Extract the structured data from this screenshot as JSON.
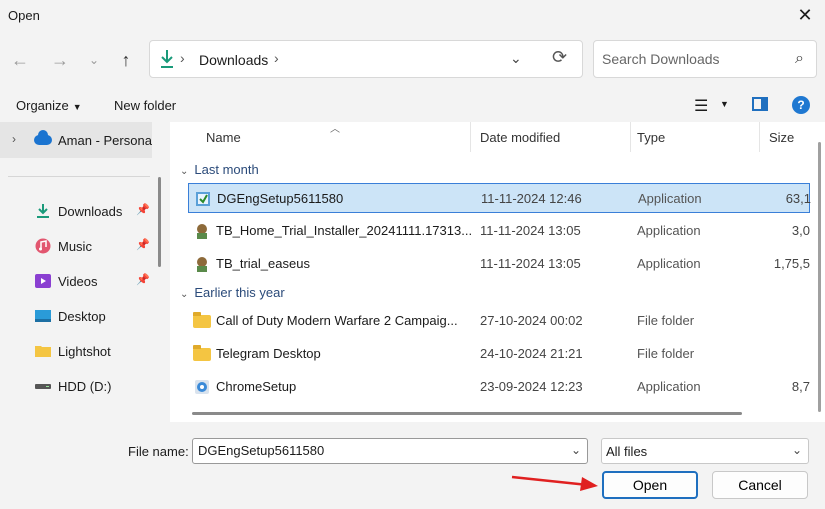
{
  "window": {
    "title": "Open"
  },
  "address": {
    "location": "Downloads"
  },
  "search": {
    "placeholder": "Search Downloads"
  },
  "toolbar": {
    "organize_label": "Organize",
    "new_folder_label": "New folder"
  },
  "sidebar": {
    "onedrive_label": "Aman - Personal",
    "items": [
      {
        "label": "Downloads",
        "icon": "download-icon",
        "pinned": true
      },
      {
        "label": "Music",
        "icon": "music-icon",
        "pinned": true
      },
      {
        "label": "Videos",
        "icon": "videos-icon",
        "pinned": true
      },
      {
        "label": "Desktop",
        "icon": "desktop-icon",
        "pinned": false
      },
      {
        "label": "Lightshot",
        "icon": "folder-icon",
        "pinned": false
      },
      {
        "label": "HDD (D:)",
        "icon": "drive-icon",
        "pinned": false
      }
    ]
  },
  "columns": {
    "name": "Name",
    "date": "Date modified",
    "type": "Type",
    "size": "Size"
  },
  "groups": [
    {
      "label": "Last month",
      "files": [
        {
          "name": "DGEngSetup5611580",
          "date": "11-11-2024 12:46",
          "type": "Application",
          "size": "63,1",
          "icon": "installer-icon",
          "selected": true
        },
        {
          "name": "TB_Home_Trial_Installer_20241111.17313...",
          "date": "11-11-2024 13:05",
          "type": "Application",
          "size": "3,0",
          "icon": "app-icon",
          "selected": false
        },
        {
          "name": "TB_trial_easeus",
          "date": "11-11-2024 13:05",
          "type": "Application",
          "size": "1,75,5",
          "icon": "app-icon",
          "selected": false
        }
      ]
    },
    {
      "label": "Earlier this year",
      "files": [
        {
          "name": "Call of Duty Modern Warfare 2 Campaig...",
          "date": "27-10-2024 00:02",
          "type": "File folder",
          "size": "",
          "icon": "folder-icon",
          "selected": false
        },
        {
          "name": "Telegram Desktop",
          "date": "24-10-2024 21:21",
          "type": "File folder",
          "size": "",
          "icon": "folder-icon",
          "selected": false
        },
        {
          "name": "ChromeSetup",
          "date": "23-09-2024 12:23",
          "type": "Application",
          "size": "8,7",
          "icon": "chrome-setup-icon",
          "selected": false
        }
      ]
    }
  ],
  "footer": {
    "filename_label": "File name:",
    "filename_value": "DGEngSetup5611580",
    "filetype_value": "All files",
    "open_label": "Open",
    "cancel_label": "Cancel"
  },
  "colors": {
    "accent": "#1f6fbf",
    "selection": "#cce4f7",
    "annotation_arrow": "#e02020"
  }
}
